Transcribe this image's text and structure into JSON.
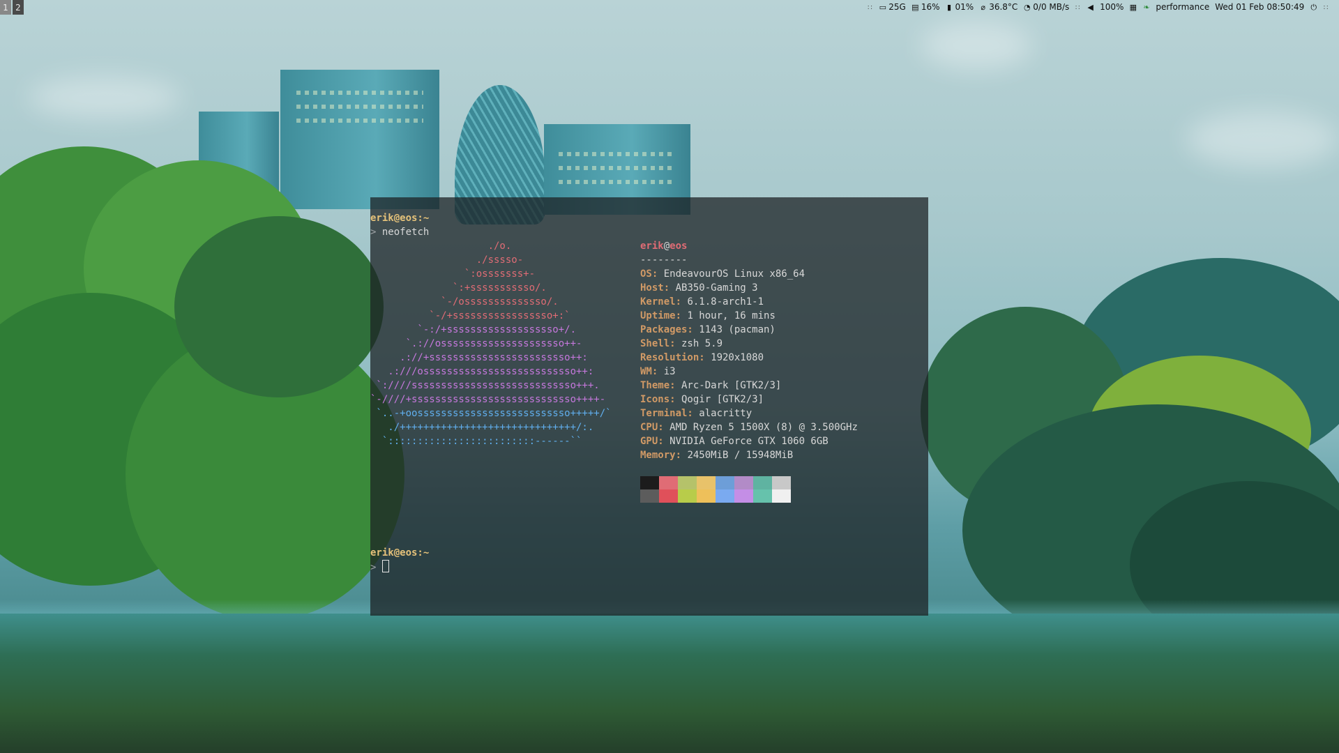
{
  "workspaces": [
    {
      "label": "1",
      "active": false
    },
    {
      "label": "2",
      "active": true
    }
  ],
  "statusbar": {
    "disk": "25G",
    "memory": "16%",
    "cpu": "01%",
    "temperature": "36.8°C",
    "network": "0/0 MB/s",
    "volume": "100%",
    "governor": "performance",
    "datetime": "Wed 01 Feb 08:50:49",
    "icons": [
      "hdd-icon",
      "memory-icon",
      "cpu-icon",
      "thermometer-icon",
      "wifi-icon",
      "speaker-icon",
      "keyboard-icon",
      "leaf-icon",
      "power-icon"
    ]
  },
  "terminal": {
    "prompt_user": "erik@eos:~",
    "prompt_symbol": ">",
    "command": "neofetch",
    "logo_lines": [
      "                    ./o.",
      "                  ./sssso-",
      "                `:osssssss+-",
      "              `:+sssssssssso/.",
      "            `-/ossssssssssssso/.",
      "          `-/+sssssssssssssssso+:`",
      "        `-:/+sssssssssssssssssso+/.",
      "      `.://osssssssssssssssssssso++-",
      "     .://+ssssssssssssssssssssssso++:",
      "   .:///ossssssssssssssssssssssssso++:",
      " `:////ssssssssssssssssssssssssssso+++.",
      "`-////+ssssssssssssssssssssssssssso++++-",
      " `..-+oossssssssssssssssssssssssso+++++/`",
      "   ./++++++++++++++++++++++++++++++/:.",
      "  `:::::::::::::::::::::::::------``"
    ],
    "header_user": "erik",
    "header_at": "@",
    "header_host": "eos",
    "divider": "--------",
    "info": [
      {
        "key": "OS",
        "value": "EndeavourOS Linux x86_64"
      },
      {
        "key": "Host",
        "value": "AB350-Gaming 3"
      },
      {
        "key": "Kernel",
        "value": "6.1.8-arch1-1"
      },
      {
        "key": "Uptime",
        "value": "1 hour, 16 mins"
      },
      {
        "key": "Packages",
        "value": "1143 (pacman)"
      },
      {
        "key": "Shell",
        "value": "zsh 5.9"
      },
      {
        "key": "Resolution",
        "value": "1920x1080"
      },
      {
        "key": "WM",
        "value": "i3"
      },
      {
        "key": "Theme",
        "value": "Arc-Dark [GTK2/3]"
      },
      {
        "key": "Icons",
        "value": "Qogir [GTK2/3]"
      },
      {
        "key": "Terminal",
        "value": "alacritty"
      },
      {
        "key": "CPU",
        "value": "AMD Ryzen 5 1500X (8) @ 3.500GHz"
      },
      {
        "key": "GPU",
        "value": "NVIDIA GeForce GTX 1060 6GB"
      },
      {
        "key": "Memory",
        "value": "2450MiB / 15948MiB"
      }
    ],
    "palette_top": [
      "#1c1c1c",
      "#e06c75",
      "#b5c26a",
      "#e8c26a",
      "#6d9ed8",
      "#b28bc7",
      "#5fb3a1",
      "#c8c8c8"
    ],
    "palette_bottom": [
      "#5c5c5c",
      "#e0505a",
      "#b8cc4a",
      "#eec05a",
      "#7aaaf0",
      "#c48ee6",
      "#66c2ac",
      "#f0f0f0"
    ],
    "second_prompt_user": "erik@eos:~",
    "second_prompt_symbol": ">"
  }
}
